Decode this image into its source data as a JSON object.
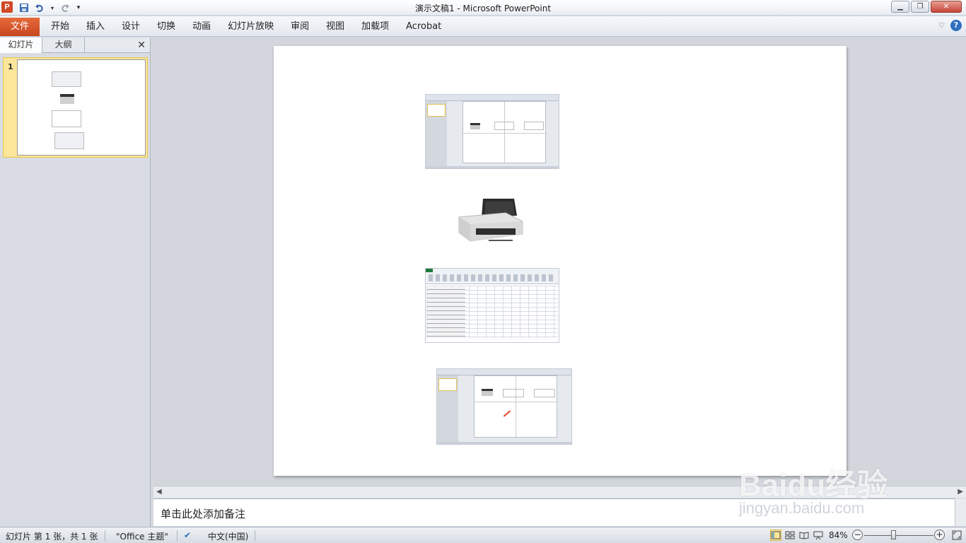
{
  "window": {
    "app_icon": "P",
    "title": "演示文稿1  -  Microsoft PowerPoint"
  },
  "ribbon": {
    "file_label": "文件",
    "tabs": [
      "开始",
      "插入",
      "设计",
      "切换",
      "动画",
      "幻灯片放映",
      "审阅",
      "视图",
      "加载项",
      "Acrobat"
    ]
  },
  "left_panel": {
    "tabs": [
      "幻灯片",
      "大纲"
    ],
    "slide_number": "1"
  },
  "notes": {
    "placeholder": "单击此处添加备注"
  },
  "status_bar": {
    "slide_info": "幻灯片 第 1 张，共 1 张",
    "theme": "\"Office 主题\"",
    "language": "中文(中国)",
    "zoom": "84%"
  },
  "watermark": {
    "brand": "Baidu经验",
    "url": "jingyan.baidu.com"
  },
  "icons": {
    "save": "save-icon",
    "undo": "undo-icon",
    "redo": "redo-icon",
    "help": "help-icon",
    "minimize": "minimize-icon",
    "restore": "restore-icon",
    "close": "close-icon"
  },
  "colors": {
    "file_tab": "#d24726",
    "selection": "#fbe69a"
  }
}
